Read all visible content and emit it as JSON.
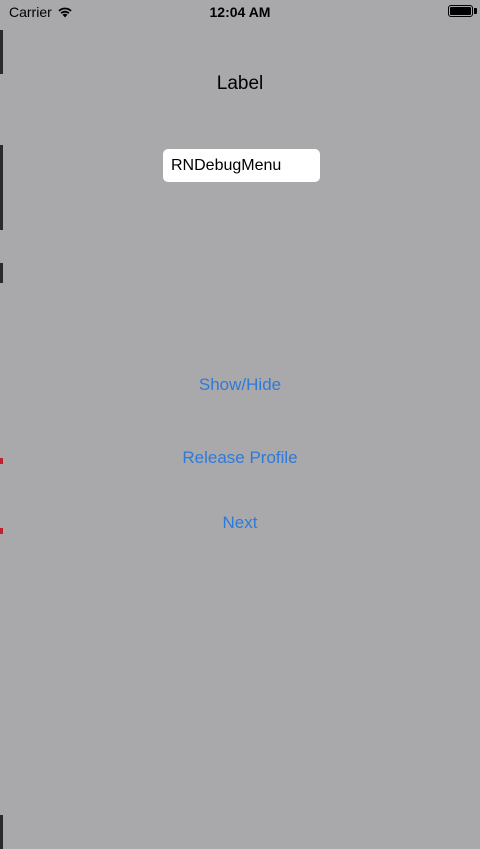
{
  "status_bar": {
    "carrier": "Carrier",
    "time": "12:04 AM",
    "wifi_icon": "wifi-icon",
    "battery_icon": "battery-icon",
    "battery_level": 1.0
  },
  "main": {
    "label": "Label",
    "text_field_value": "RNDebugMenu",
    "buttons": {
      "show_hide": "Show/Hide",
      "release_profile": "Release Profile",
      "next": "Next"
    }
  },
  "colors": {
    "background": "#a9a8ab",
    "button_text": "#2f7ad8",
    "text_field_bg": "#ffffff"
  }
}
